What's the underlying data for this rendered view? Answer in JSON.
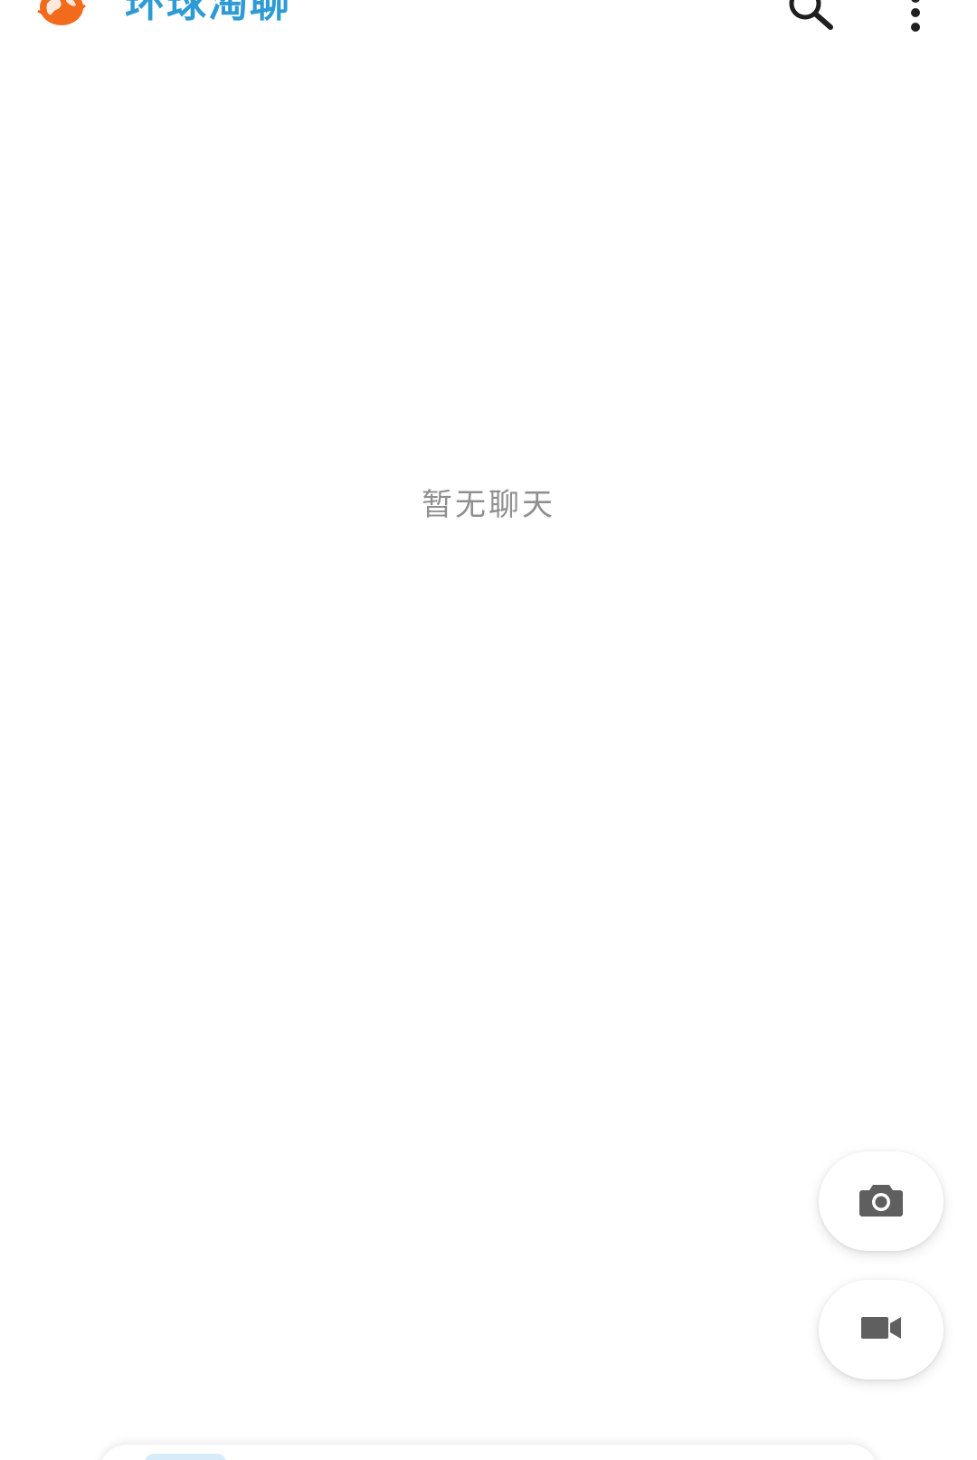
{
  "app": {
    "title": "环球淘聊",
    "brand_color": "#2f9bd4",
    "logo_color": "#f26a1b",
    "logo_icon": "globe-logo-icon"
  },
  "appbar": {
    "search_icon": "search-icon",
    "more_icon": "more-vertical-icon"
  },
  "main": {
    "empty_message": "暂无聊天"
  },
  "fabs": {
    "camera_icon": "camera-icon",
    "video_icon": "video-camera-icon",
    "icon_color": "#5f5f5f"
  }
}
